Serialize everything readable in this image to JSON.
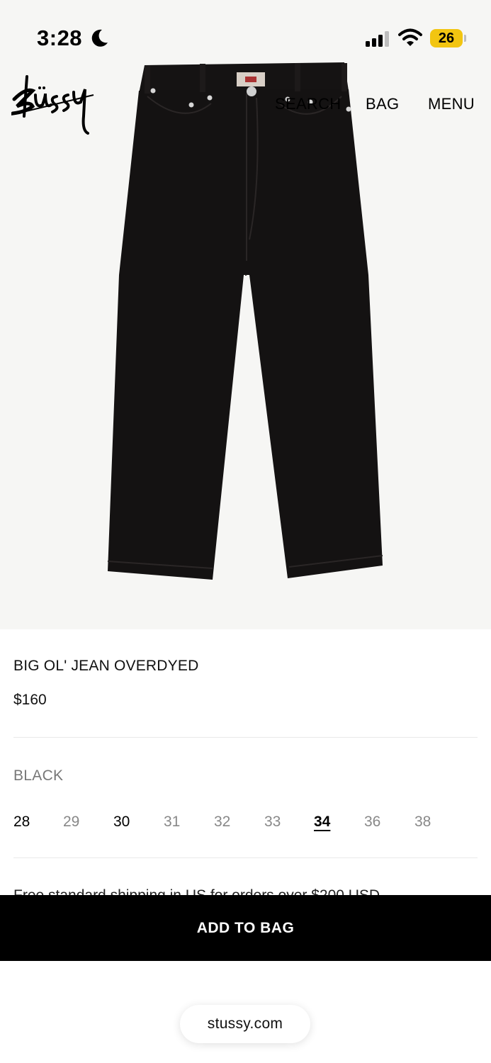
{
  "status_bar": {
    "time": "3:28",
    "battery": "26",
    "icons": [
      "moon-icon",
      "cellular-signal-icon",
      "wifi-icon",
      "battery-icon"
    ]
  },
  "header": {
    "logo_text": "Stüssy",
    "nav": {
      "search": "SEARCH",
      "bag": "BAG",
      "menu": "MENU"
    }
  },
  "product": {
    "image_description_icon": "jeans-product-image",
    "title": "BIG OL' JEAN OVERDYED",
    "price": "$160",
    "color": "BLACK",
    "sizes": [
      "28",
      "29",
      "30",
      "31",
      "32",
      "33",
      "34",
      "36",
      "38"
    ],
    "available_sizes": [
      "28",
      "30",
      "34"
    ],
    "selected_size": "34",
    "shipping_note": "Free standard shipping in US for orders over $200 USD"
  },
  "actions": {
    "add_to_bag": "ADD TO BAG"
  },
  "browser": {
    "url": "stussy.com"
  },
  "colors": {
    "hero_background": "#f6f6f4",
    "button_background": "#000000",
    "battery": "#f2c511",
    "unavailable_size": "#888888"
  }
}
